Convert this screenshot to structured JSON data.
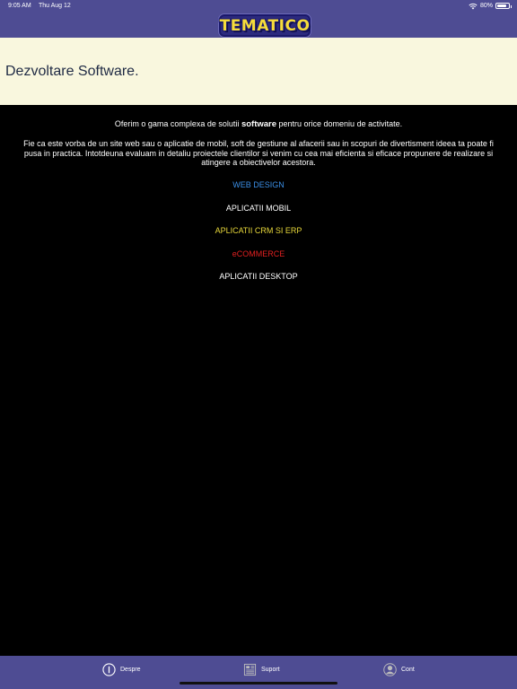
{
  "status_bar": {
    "time": "9:05 AM",
    "date": "Thu Aug 12",
    "battery": "80%",
    "battery_level": 0.8
  },
  "app": {
    "logo_text": "TEMATICO",
    "brand_color": "#4e4c93",
    "logo_color": "#f5dc3a"
  },
  "header": {
    "title": "Dezvoltare Software."
  },
  "main": {
    "intro_before": "Oferim o gama complexa de solutii ",
    "intro_bold": "software",
    "intro_after": " pentru orice domeniu de activitate.",
    "description": "Fie ca este vorba de un site web sau o aplicatie de mobil, soft de gestiune al afacerii sau in scopuri de divertisment ideea ta poate fi pusa in practica. Intotdeuna evaluam in detaliu proiectele clientilor si venim cu cea mai eficienta si eficace propunere de realizare si atingere a obiectivelor acestora.",
    "categories": [
      {
        "label": "WEB DESIGN",
        "color": "#3b8fe6"
      },
      {
        "label": "APLICATII MOBIL",
        "color": "#ffffff"
      },
      {
        "label": "APLICATII CRM SI ERP",
        "color": "#e8d83a"
      },
      {
        "label": "eCOMMERCE",
        "color": "#e02020"
      },
      {
        "label": "APLICATII DESKTOP",
        "color": "#ffffff"
      }
    ]
  },
  "tabbar": {
    "tabs": [
      {
        "label": "Despre",
        "icon": "info-icon"
      },
      {
        "label": "Suport",
        "icon": "newspaper-icon"
      },
      {
        "label": "Cont",
        "icon": "person-icon"
      }
    ]
  }
}
